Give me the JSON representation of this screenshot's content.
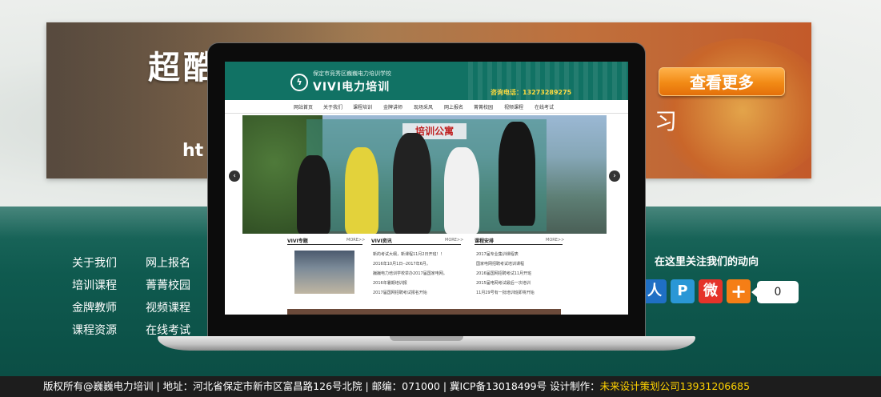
{
  "banner": {
    "title": "超酷",
    "sub": "ht",
    "right_text": "习",
    "more_button": "查看更多"
  },
  "footer_links": [
    "关于我们",
    "网上报名",
    "培训课程",
    "菁菁校园",
    "金牌教师",
    "视频课程",
    "课程资源",
    "在线考试"
  ],
  "follow": {
    "title": "在这里关注我们的动向",
    "share_count": "0",
    "icons": [
      "renren-icon",
      "pengyou-icon",
      "weibo-icon",
      "share-plus-icon"
    ]
  },
  "bottom_bar": {
    "text": "版权所有@巍巍电力培训 | 地址：河北省保定市新市区富昌路126号北院 | 邮编：071000 | 冀ICP备13018499号  设计制作：",
    "designer": "未来设计策划公司13931206685"
  },
  "site": {
    "school": "保定市竞秀区巍巍电力培训学校",
    "name": "VIVI电力培训",
    "phone": "咨询电话：13273289275",
    "nav": [
      "网站首页",
      "关于我们",
      "课程培训",
      "金牌讲师",
      "现场采风",
      "网上报名",
      "菁菁校园",
      "视频课程",
      "在线考试"
    ],
    "slider_sign": "培训公寓",
    "columns": [
      {
        "title": "VIVI专题",
        "more": "MORE>>"
      },
      {
        "title": "VIVI资讯",
        "more": "MORE>>"
      },
      {
        "title": "课程安排",
        "more": "MORE>>"
      }
    ],
    "news": [
      "新的考试大纲，新课程11月2日开班！！",
      "2016年10月1日--2017年6月。",
      "巍巍电力培训学校举办2017届国家电网。",
      "2016年暑期培训报",
      "2017届国网招聘考试报名开始"
    ],
    "schedule": [
      "2017届专业集训课程表",
      "国家电网招聘考试培训课程",
      "2016届国网招聘考试11月开班",
      "2015届电网考试最后一次培训",
      "11月29号有一批培训班即将开始"
    ]
  }
}
